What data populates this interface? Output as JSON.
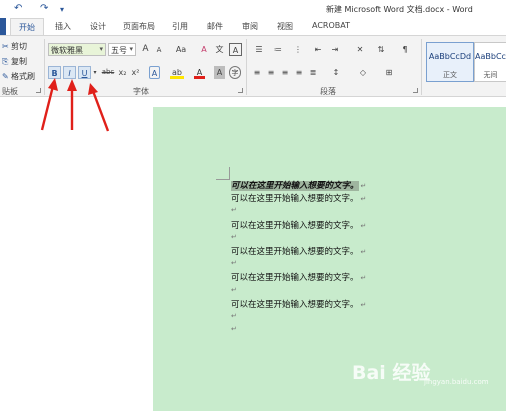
{
  "quick_access": {
    "undo": "↶",
    "redo": "↷",
    "more": "▾"
  },
  "window_title": "新建 Microsoft Word 文档.docx - Word",
  "tabs": [
    {
      "label": "开始",
      "active": true
    },
    {
      "label": "插入"
    },
    {
      "label": "设计"
    },
    {
      "label": "页面布局"
    },
    {
      "label": "引用"
    },
    {
      "label": "邮件"
    },
    {
      "label": "审阅"
    },
    {
      "label": "视图"
    },
    {
      "label": "ACROBAT"
    }
  ],
  "clipboard": {
    "cut": "剪切",
    "copy": "复制",
    "format_painter": "格式刷",
    "group_label": "贴板"
  },
  "font": {
    "name": "微软雅黑",
    "size": "五号",
    "grow": "A",
    "shrink": "A",
    "case": "Aa",
    "clear": "A",
    "phonetic": "文",
    "border": "A",
    "bold": "B",
    "italic": "I",
    "underline": "U",
    "strike": "abc",
    "subscript": "x₂",
    "superscript": "x²",
    "effects": "A",
    "highlight": "ab",
    "color": "A",
    "shade": "A",
    "enclose": "字",
    "group_label": "字体"
  },
  "paragraph": {
    "group_label": "段落"
  },
  "styles": [
    {
      "sample": "AaBbCcDd",
      "name": "正文"
    },
    {
      "sample": "AaBbCc",
      "name": "无间"
    }
  ],
  "accent_color": "#2b579a",
  "arrow_color": "#e0201a",
  "page_color": "#c8ebcc",
  "document_lines": [
    {
      "text": "可以在这里开始输入想要的文字。",
      "mark": "↵",
      "selected": true
    },
    {
      "text": "可以在这里开始输入想要的文字。",
      "mark": "↵"
    },
    {
      "text": "",
      "mark": "↵"
    },
    {
      "text": "可以在这里开始输入想要的文字。",
      "mark": "↵"
    },
    {
      "text": "",
      "mark": "↵"
    },
    {
      "text": "可以在这里开始输入想要的文字。",
      "mark": "↵"
    },
    {
      "text": "",
      "mark": "↵"
    },
    {
      "text": "可以在这里开始输入想要的文字。",
      "mark": "↵"
    },
    {
      "text": "",
      "mark": "↵"
    },
    {
      "text": "可以在这里开始输入想要的文字。",
      "mark": "↵"
    },
    {
      "text": "",
      "mark": "↵"
    },
    {
      "text": "",
      "mark": "↵"
    }
  ],
  "watermark": {
    "main": "Bai 经验",
    "sub": "jingyan.baidu.com"
  }
}
